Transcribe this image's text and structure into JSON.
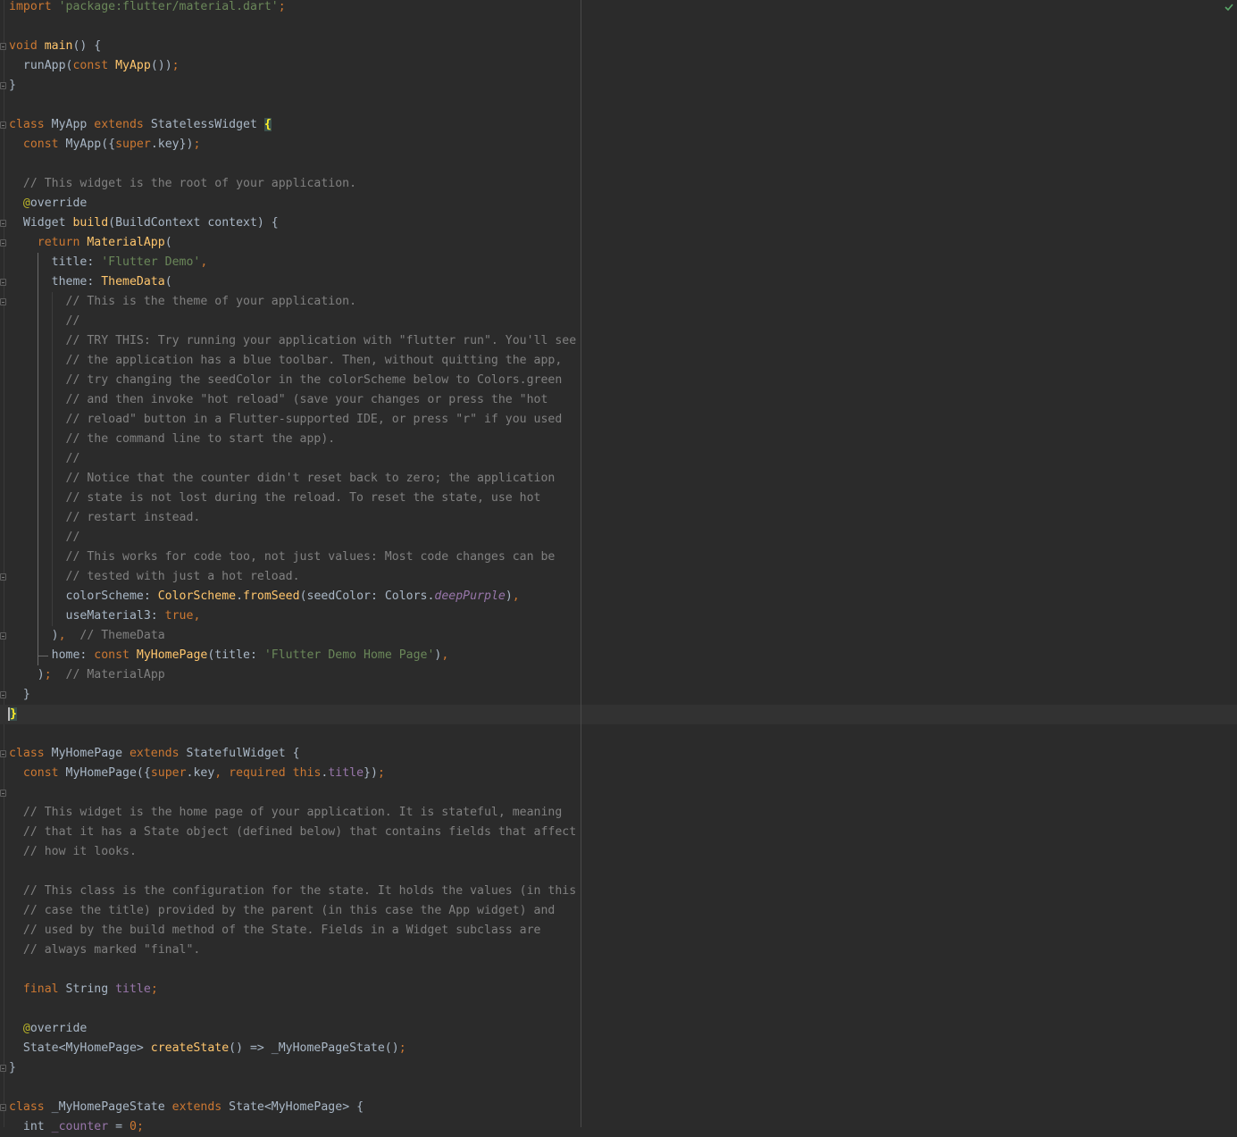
{
  "editor": {
    "status_icon": "check-icon",
    "lines": [
      [
        {
          "t": "import ",
          "c": "kw"
        },
        {
          "t": "'package:flutter/material.dart'",
          "c": "str"
        },
        {
          "t": ";",
          "c": "kw"
        }
      ],
      [],
      [
        {
          "t": "void ",
          "c": "kw"
        },
        {
          "t": "main",
          "c": "fn"
        },
        {
          "t": "() {"
        }
      ],
      [
        {
          "t": "  runApp("
        },
        {
          "t": "const ",
          "c": "kw"
        },
        {
          "t": "MyApp",
          "c": "fn"
        },
        {
          "t": "())"
        },
        {
          "t": ";",
          "c": "kw"
        }
      ],
      [
        {
          "t": "}"
        }
      ],
      [],
      [
        {
          "t": "class ",
          "c": "kw"
        },
        {
          "t": "MyApp "
        },
        {
          "t": "extends ",
          "c": "kw"
        },
        {
          "t": "StatelessWidget "
        },
        {
          "t": "{",
          "c": "brace-hl"
        }
      ],
      [
        {
          "t": "  "
        },
        {
          "t": "const ",
          "c": "kw"
        },
        {
          "t": "MyApp({"
        },
        {
          "t": "super",
          "c": "kw"
        },
        {
          "t": ".key})"
        },
        {
          "t": ";",
          "c": "kw"
        }
      ],
      [],
      [
        {
          "t": "  // This widget is the root of your application.",
          "c": "cm"
        }
      ],
      [
        {
          "t": "  "
        },
        {
          "t": "@",
          "c": "ann"
        },
        {
          "t": "override"
        }
      ],
      [
        {
          "t": "  Widget "
        },
        {
          "t": "build",
          "c": "fn"
        },
        {
          "t": "(BuildContext context) {"
        }
      ],
      [
        {
          "t": "    "
        },
        {
          "t": "return ",
          "c": "kw"
        },
        {
          "t": "MaterialApp",
          "c": "fn"
        },
        {
          "t": "("
        }
      ],
      [
        {
          "t": "      title: "
        },
        {
          "t": "'Flutter Demo'",
          "c": "str"
        },
        {
          "t": ",",
          "c": "kw"
        }
      ],
      [
        {
          "t": "      theme: "
        },
        {
          "t": "ThemeData",
          "c": "fn"
        },
        {
          "t": "("
        }
      ],
      [
        {
          "t": "        // This is the theme of your application.",
          "c": "cm"
        }
      ],
      [
        {
          "t": "        //",
          "c": "cm"
        }
      ],
      [
        {
          "t": "        // TRY THIS: Try running your application with \"flutter run\". You'll see",
          "c": "cm"
        }
      ],
      [
        {
          "t": "        // the application has a blue toolbar. Then, without quitting the app,",
          "c": "cm"
        }
      ],
      [
        {
          "t": "        // try changing the seedColor in the colorScheme below to Colors.green",
          "c": "cm"
        }
      ],
      [
        {
          "t": "        // and then invoke \"hot reload\" (save your changes or press the \"hot",
          "c": "cm"
        }
      ],
      [
        {
          "t": "        // reload\" button in a Flutter-supported IDE, or press \"r\" if you used",
          "c": "cm"
        }
      ],
      [
        {
          "t": "        // the command line to start the app).",
          "c": "cm"
        }
      ],
      [
        {
          "t": "        //",
          "c": "cm"
        }
      ],
      [
        {
          "t": "        // Notice that the counter didn't reset back to zero; the application",
          "c": "cm"
        }
      ],
      [
        {
          "t": "        // state is not lost during the reload. To reset the state, use hot",
          "c": "cm"
        }
      ],
      [
        {
          "t": "        // restart instead.",
          "c": "cm"
        }
      ],
      [
        {
          "t": "        //",
          "c": "cm"
        }
      ],
      [
        {
          "t": "        // This works for code too, not just values: Most code changes can be",
          "c": "cm"
        }
      ],
      [
        {
          "t": "        // tested with just a hot reload.",
          "c": "cm"
        }
      ],
      [
        {
          "t": "        colorScheme: "
        },
        {
          "t": "ColorScheme",
          "c": "fn"
        },
        {
          "t": "."
        },
        {
          "t": "fromSeed",
          "c": "fn"
        },
        {
          "t": "(seedColor: Colors."
        },
        {
          "t": "deepPurple",
          "c": "ital"
        },
        {
          "t": ")"
        },
        {
          "t": ",",
          "c": "kw"
        }
      ],
      [
        {
          "t": "        useMaterial3: "
        },
        {
          "t": "true",
          "c": "kw"
        },
        {
          "t": ",",
          "c": "kw"
        }
      ],
      [
        {
          "t": "      )"
        },
        {
          "t": ",",
          "c": "kw"
        },
        {
          "t": "  "
        },
        {
          "t": "// ThemeData",
          "c": "cm"
        }
      ],
      [
        {
          "t": "      home: "
        },
        {
          "t": "const ",
          "c": "kw"
        },
        {
          "t": "MyHomePage",
          "c": "fn"
        },
        {
          "t": "(title: "
        },
        {
          "t": "'Flutter Demo Home Page'",
          "c": "str"
        },
        {
          "t": ")"
        },
        {
          "t": ",",
          "c": "kw"
        }
      ],
      [
        {
          "t": "    )"
        },
        {
          "t": ";",
          "c": "kw"
        },
        {
          "t": "  "
        },
        {
          "t": "// MaterialApp",
          "c": "cm"
        }
      ],
      [
        {
          "t": "  }"
        }
      ],
      [
        {
          "t": "}",
          "c": "brace-hl caret"
        }
      ],
      [],
      [
        {
          "t": "class ",
          "c": "kw"
        },
        {
          "t": "MyHomePage "
        },
        {
          "t": "extends ",
          "c": "kw"
        },
        {
          "t": "StatefulWidget {"
        }
      ],
      [
        {
          "t": "  "
        },
        {
          "t": "const ",
          "c": "kw"
        },
        {
          "t": "MyHomePage({"
        },
        {
          "t": "super",
          "c": "kw"
        },
        {
          "t": ".key"
        },
        {
          "t": ", ",
          "c": "kw"
        },
        {
          "t": "required this",
          "c": "kw"
        },
        {
          "t": "."
        },
        {
          "t": "title",
          "c": "fld"
        },
        {
          "t": "})"
        },
        {
          "t": ";",
          "c": "kw"
        }
      ],
      [],
      [
        {
          "t": "  // This widget is the home page of your application. It is stateful, meaning",
          "c": "cm"
        }
      ],
      [
        {
          "t": "  // that it has a State object (defined below) that contains fields that affect",
          "c": "cm"
        }
      ],
      [
        {
          "t": "  // how it looks.",
          "c": "cm"
        }
      ],
      [],
      [
        {
          "t": "  // This class is the configuration for the state. It holds the values (in this",
          "c": "cm"
        }
      ],
      [
        {
          "t": "  // case the title) provided by the parent (in this case the App widget) and",
          "c": "cm"
        }
      ],
      [
        {
          "t": "  // used by the build method of the State. Fields in a Widget subclass are",
          "c": "cm"
        }
      ],
      [
        {
          "t": "  // always marked \"final\".",
          "c": "cm"
        }
      ],
      [],
      [
        {
          "t": "  "
        },
        {
          "t": "final ",
          "c": "kw"
        },
        {
          "t": "String "
        },
        {
          "t": "title",
          "c": "fld"
        },
        {
          "t": ";",
          "c": "kw"
        }
      ],
      [],
      [
        {
          "t": "  "
        },
        {
          "t": "@",
          "c": "ann"
        },
        {
          "t": "override"
        }
      ],
      [
        {
          "t": "  State<MyHomePage> "
        },
        {
          "t": "createState",
          "c": "fn"
        },
        {
          "t": "() => _MyHomePageState()"
        },
        {
          "t": ";",
          "c": "kw"
        }
      ],
      [
        {
          "t": "}"
        }
      ],
      [],
      [
        {
          "t": "class ",
          "c": "kw"
        },
        {
          "t": "_MyHomePageState "
        },
        {
          "t": "extends ",
          "c": "kw"
        },
        {
          "t": "State<MyHomePage> {"
        }
      ],
      [
        {
          "t": "  int "
        },
        {
          "t": "_counter",
          "c": "fld"
        },
        {
          "t": " = "
        },
        {
          "t": "0",
          "c": "kw"
        },
        {
          "t": ";",
          "c": "kw"
        }
      ]
    ]
  }
}
